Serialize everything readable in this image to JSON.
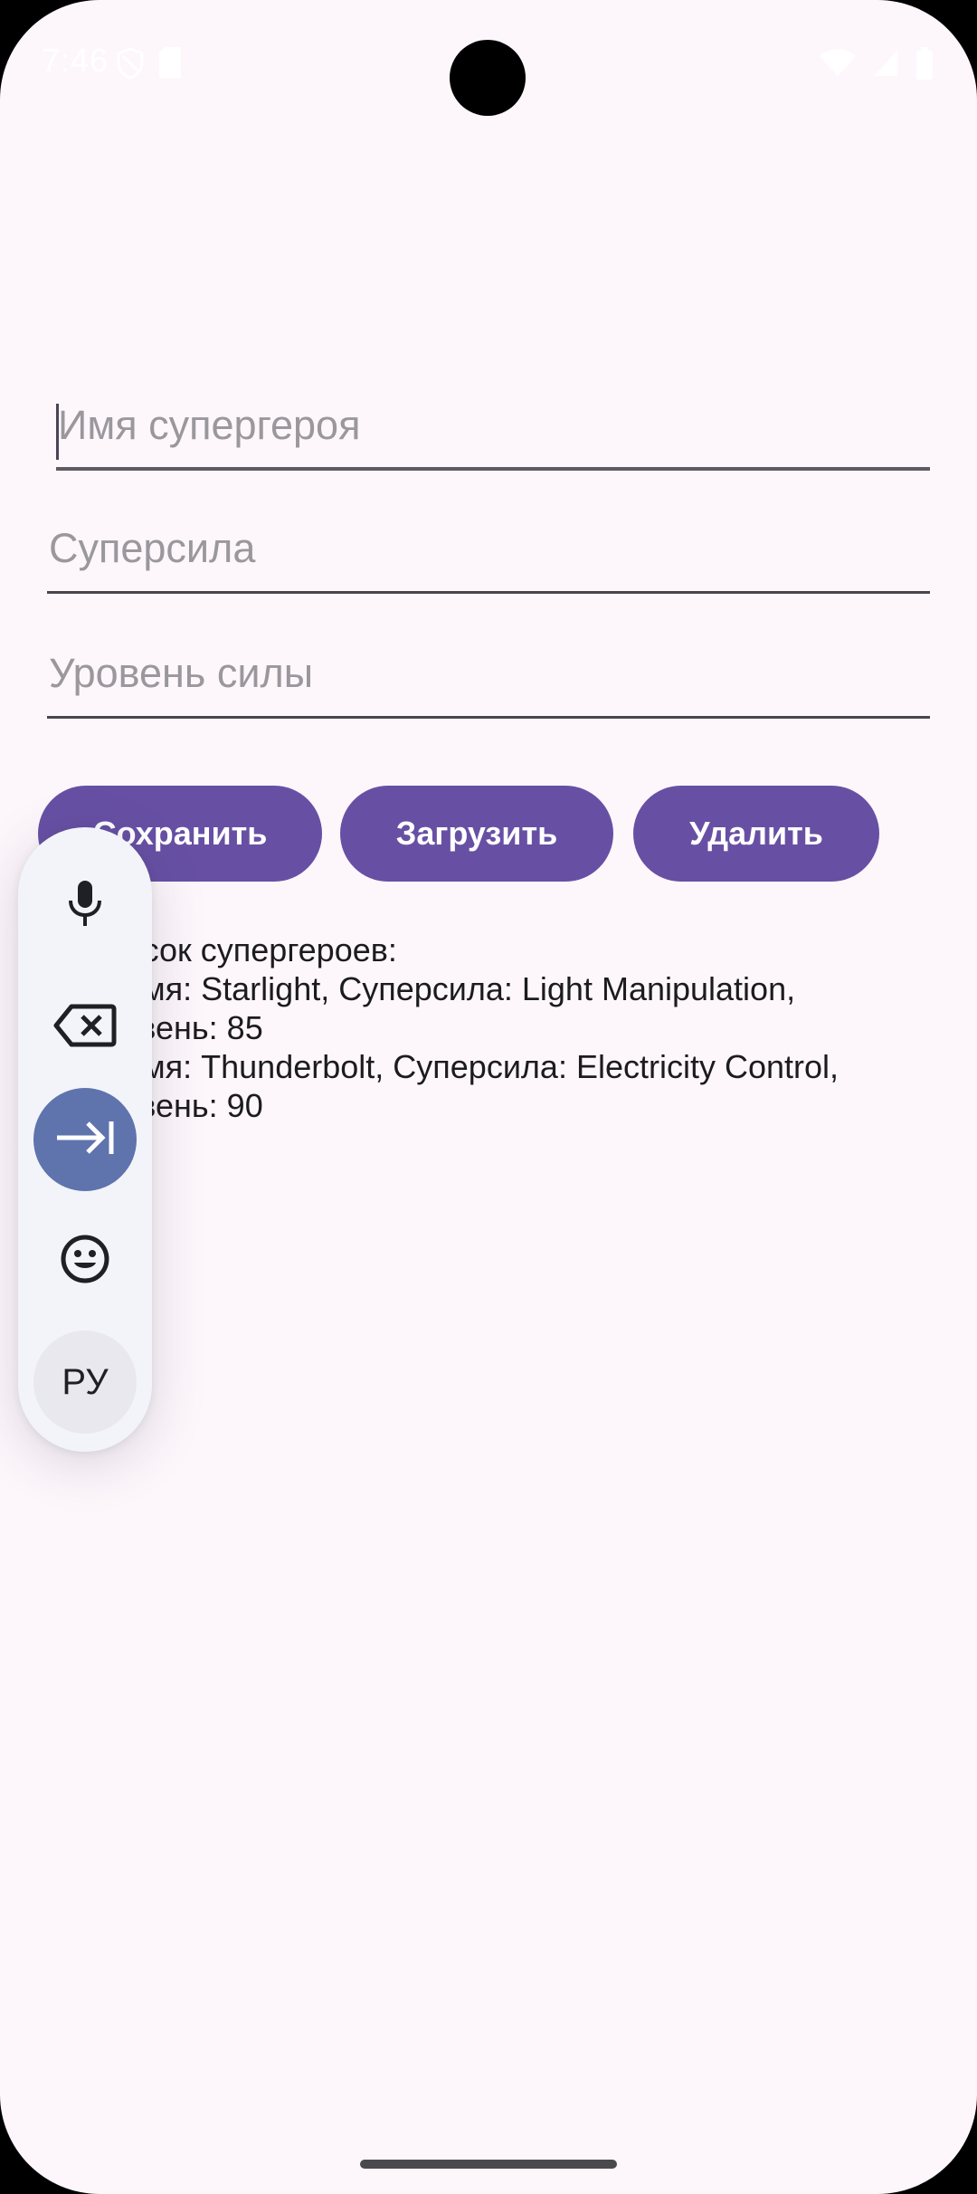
{
  "status_bar": {
    "time": "7:46",
    "icons": [
      "vpn-shield-icon",
      "sim-card-icon",
      "wifi-icon",
      "cell-signal-icon",
      "battery-icon"
    ]
  },
  "form": {
    "name_placeholder": "Имя супергероя",
    "power_placeholder": "Суперсила",
    "level_placeholder": "Уровень силы"
  },
  "buttons": {
    "save": "Сохранить",
    "load": "Загрузить",
    "delete": "Удалить"
  },
  "list": {
    "line1": "Список супергероев:",
    "line2": "1. Имя: Starlight, Суперсила: Light Manipulation,",
    "line3": "Уровень: 85",
    "line4": "2. Имя: Thunderbolt, Суперсила: Electricity Control,",
    "line5": "Уровень: 90"
  },
  "keyboard_toolbar": {
    "tools": [
      "mic-icon",
      "backspace-icon",
      "tab-next-icon",
      "emoji-icon"
    ],
    "language": "РУ"
  },
  "colors": {
    "background": "#fdf7fc",
    "primary": "#6750a4",
    "toolbar_accent": "#5f73ad"
  }
}
